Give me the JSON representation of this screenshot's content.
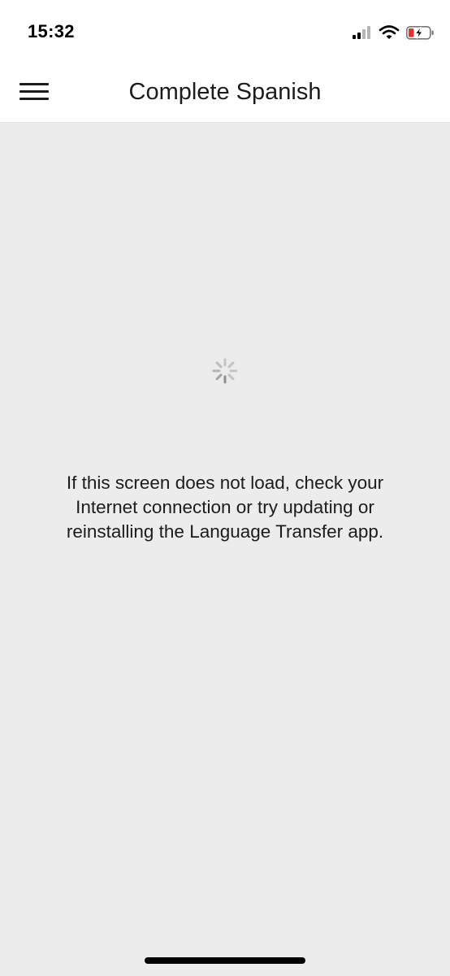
{
  "status_bar": {
    "time": "15:32",
    "icons": [
      "cellular-signal-icon",
      "wifi-icon",
      "battery-charging-icon"
    ],
    "battery_color": "#e5332a"
  },
  "nav": {
    "title": "Complete Spanish",
    "menu_icon": "hamburger-menu-icon"
  },
  "content": {
    "spinner_icon": "loading-spinner-icon",
    "message_line1": "If this screen does not load, check your",
    "message_line2": "Internet connection or try updating or",
    "message_line3": "reinstalling the Language Transfer app."
  }
}
